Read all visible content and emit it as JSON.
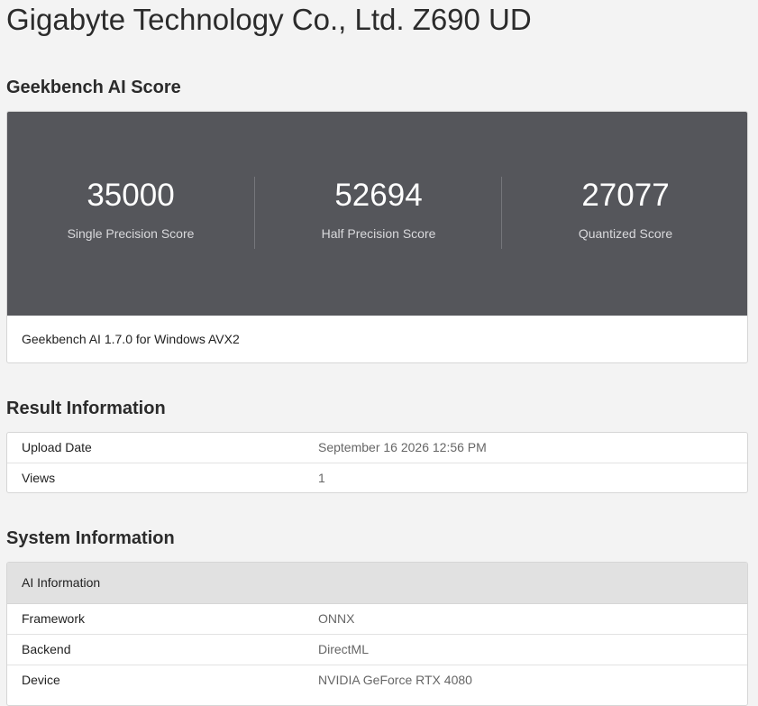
{
  "page": {
    "title": "Gigabyte Technology Co., Ltd. Z690 UD"
  },
  "score_section": {
    "heading": "Geekbench AI Score",
    "scores": [
      {
        "value": "35000",
        "label": "Single Precision Score"
      },
      {
        "value": "52694",
        "label": "Half Precision Score"
      },
      {
        "value": "27077",
        "label": "Quantized Score"
      }
    ],
    "footer": "Geekbench AI 1.7.0 for Windows AVX2"
  },
  "result_section": {
    "heading": "Result Information",
    "rows": [
      {
        "key": "Upload Date",
        "value": "September 16 2026 12:56 PM"
      },
      {
        "key": "Views",
        "value": "1"
      }
    ]
  },
  "system_section": {
    "heading": "System Information",
    "subheading": "AI Information",
    "rows": [
      {
        "key": "Framework",
        "value": "ONNX"
      },
      {
        "key": "Backend",
        "value": "DirectML"
      },
      {
        "key": "Device",
        "value": "NVIDIA GeForce RTX 4080"
      }
    ]
  },
  "colors": {
    "background": "#f3f3f3",
    "score_panel": "#55565b",
    "card": "#ffffff",
    "table_header": "#e1e1e1"
  }
}
